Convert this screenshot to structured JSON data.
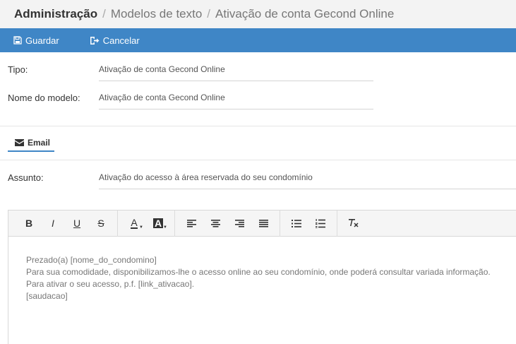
{
  "breadcrumb": {
    "root": "Administração",
    "level1": "Modelos de texto",
    "level2": "Ativação de conta Gecond Online",
    "separator": "/"
  },
  "toolbar": {
    "save_label": "Guardar",
    "cancel_label": "Cancelar",
    "color": "#3f86c6"
  },
  "form": {
    "tipo_label": "Tipo:",
    "tipo_value": "Ativação de conta Gecond Online",
    "nome_label": "Nome do modelo:",
    "nome_value": "Ativação de conta Gecond Online"
  },
  "tabs": {
    "email_label": "Email"
  },
  "email": {
    "assunto_label": "Assunto:",
    "assunto_value": "Ativação do acesso à área reservada do seu condomínio",
    "editor_toolbar": {
      "bold": "B",
      "italic": "I",
      "underline": "U",
      "strike": "S",
      "font_color": "A",
      "bg_color": "A"
    },
    "body_lines": [
      "Prezado(a) [nome_do_condomino]",
      "Para sua comodidade, disponibilizamos-lhe o acesso online ao seu condomínio, onde poderá consultar variada informação.",
      "Para ativar o seu acesso, p.f. [link_ativacao].",
      "[saudacao]"
    ]
  }
}
